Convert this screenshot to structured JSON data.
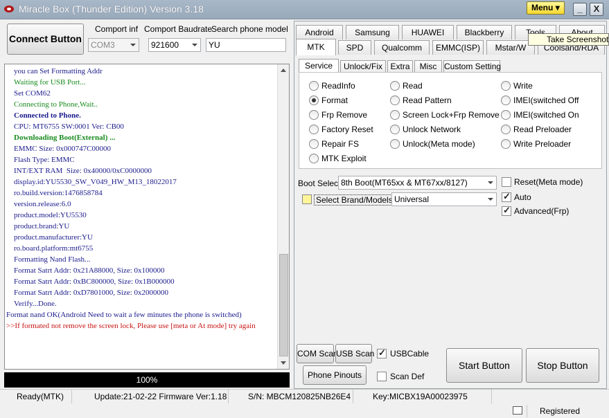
{
  "window": {
    "title": "Miracle Box (Thunder Edition) Version 3.18",
    "menu_label": "Menu",
    "minimize": "_",
    "restore": "□",
    "close": "X"
  },
  "connect": {
    "button_label": "Connect Button",
    "comport_label": "Comport inf",
    "comport_value": "COM3",
    "baudrate_label": "Comport Baudrate",
    "baudrate_value": "921600",
    "search_label": "Search phone model",
    "search_value": "YU"
  },
  "log": {
    "lines": [
      "you can Set Formatting Addr",
      "Waiting for USB Port...",
      "Set COM62",
      "Connecting to Phone,Wait..",
      "Connected to Phone.",
      "CPU: MT6755 SW:0001 Ver: CB00",
      "Downloading Boot(External) ...",
      "EMMC Size: 0x000747C00000",
      "Flash Type: EMMC",
      "INT/EXT RAM  Size: 0x40000/0xC0000000",
      "display.id:YU5530_SW_V049_HW_M13_18022017",
      "ro.build.version:1476858784",
      "version.release:6.0",
      "product.model:YU5530",
      "product.brand:YU",
      "product.manufacturer:YU",
      "ro.board.platform:mt6755",
      "Formatting Nand Flash...",
      "Format Satrt Addr: 0x21A88000, Size: 0x100000",
      "Format Satrt Addr: 0xBC800000, Size: 0x1B000000",
      "Format Satrt Addr: 0xD7801000, Size: 0x2000000",
      "Verify...Done.",
      "Format nand OK(Android Need to wait a few minutes the phone is switched)",
      ">>If formated not remove the screen lock, Please use [meta or At mode] try again"
    ]
  },
  "progress": {
    "label": "100%",
    "value": 1.0
  },
  "tabs_row1": [
    "Android",
    "Samsung",
    "HUAWEI",
    "Blackberry",
    "Tools",
    "About"
  ],
  "tabs_row2": [
    "MTK",
    "SPD",
    "Qualcomm",
    "EMMC(ISP)",
    "Mstar/W",
    "Coolsand/RDA"
  ],
  "subtabs": [
    "Service",
    "Unlock/Fix",
    "Extra",
    "Misc",
    "Custom Setting"
  ],
  "tooltip": "Take Screenshot",
  "service_options": {
    "col1": [
      "ReadInfo",
      "Format",
      "Frp Remove",
      "Factory Reset",
      "Repair FS",
      "MTK Exploit"
    ],
    "col2": [
      "Read",
      "Read Pattern",
      "Screen Lock+Frp Remove",
      "Unlock Network",
      "Unlock(Meta mode)"
    ],
    "col3": [
      "Write",
      "IMEI(switched Off",
      "IMEI(switched On",
      "Read Preloader",
      "Write Preloader"
    ],
    "selected": "Format"
  },
  "boot": {
    "label": "Boot Select:",
    "value": "8th Boot(MT65xx & MT67xx/8127)",
    "reset_meta_label": "Reset(Meta mode)",
    "auto_label": "Auto",
    "advanced_label": "Advanced(Frp)",
    "brand_label": "Select Brand/Models",
    "brand_value": "Universal"
  },
  "controls": {
    "com_scan": "COM Scan",
    "usb_scan": "USB Scan",
    "usb_cable": "USBCable",
    "phone_pinouts": "Phone Pinouts",
    "scan_def": "Scan Def",
    "start": "Start Button",
    "stop": "Stop Button"
  },
  "status": {
    "state": "Ready(MTK)",
    "update": "Update:21-02-22 Firmware Ver:1.18",
    "serial": "S/N: MBCM120825NB26E4",
    "key": "Key:MICBX19A00023975",
    "registered": "Registered"
  },
  "colors": {
    "log_navy": "#1a1a8c",
    "log_green": "#178a1d",
    "log_red": "#c81414",
    "menu_yellow": "#f5d830",
    "brand_swatch": "#fff59a"
  }
}
